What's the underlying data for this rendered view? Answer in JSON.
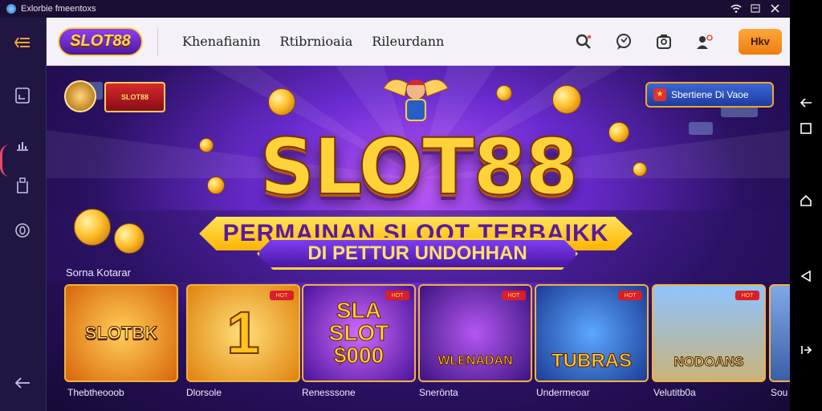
{
  "statusbar": {
    "app_title": "Exlorbie fmeentoxs"
  },
  "header": {
    "logo_text": "SLOT88",
    "nav": [
      "Khenafianin",
      "Rtibrnioaia",
      "Rileurdann"
    ],
    "cta_label": "Hkv"
  },
  "hero": {
    "badge_left_text": "SLOT88",
    "badge_right_text": "Sbertiene Di Vaoe",
    "title": "SLOT88",
    "banner_line1": "PERMAINAN SLOOT TERBAIKK",
    "banner_line2": "DI PETTUR UNDOHHAN"
  },
  "games_section": {
    "title": "Sorna Kotarar",
    "cards": [
      {
        "art": "SLOTBK",
        "tag": "",
        "label": "Thebtheooob"
      },
      {
        "art": "1",
        "tag": "",
        "label": "Dlorsole"
      },
      {
        "art": "SLA SLOT $000",
        "tag": "",
        "label": "Renesssone"
      },
      {
        "art": "WLENADAN",
        "tag": "",
        "label": "Snerönta"
      },
      {
        "art": "TUBRAS",
        "tag": "",
        "label": "Undermeoar"
      },
      {
        "art": "NODOANS",
        "tag": "",
        "label": "Velutitb0a"
      },
      {
        "art": "",
        "tag": "",
        "label": "Sou"
      }
    ]
  },
  "colors": {
    "accent": "#ffd23a",
    "cta": "#ef7d10",
    "card_border": "#f1b43b",
    "hero_bg": "#6a2bd0"
  },
  "icons": {
    "statusbar": [
      "wifi-icon",
      "window-restore-icon",
      "close-icon"
    ],
    "leftnav": [
      "menu-icon",
      "file-icon",
      "chart-icon",
      "clipboard-icon",
      "info-icon",
      "back-arrow-icon"
    ],
    "header": [
      "search-icon",
      "chat-icon",
      "wallet-icon",
      "user-settings-icon"
    ],
    "rightbar": [
      "back-icon",
      "stop-icon",
      "home-icon",
      "triangle-back-icon",
      "exit-icon"
    ]
  }
}
